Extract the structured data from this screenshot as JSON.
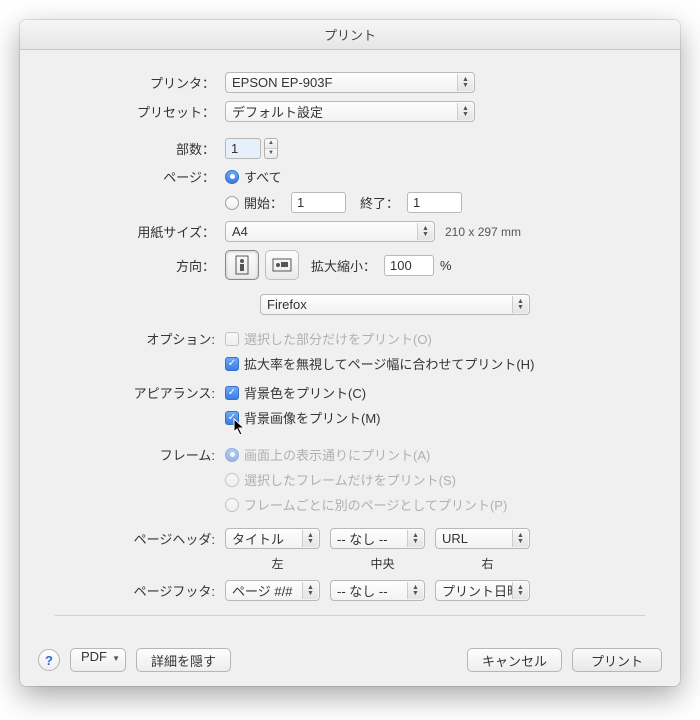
{
  "title": "プリント",
  "labels": {
    "printer": "プリンタ：",
    "preset": "プリセット：",
    "copies": "部数：",
    "pages": "ページ：",
    "all": "すべて",
    "from": "開始：",
    "to": "終了：",
    "paperSize": "用紙サイズ：",
    "paperSizeNote": "210 x 297 mm",
    "orientation": "方向：",
    "scale": "拡大縮小：",
    "percent": "%",
    "options": "オプション:",
    "appearance": "アピアランス:",
    "frame": "フレーム:",
    "header": "ページヘッダ:",
    "footer": "ページフッタ:",
    "hfLeft": "左",
    "hfCenter": "中央",
    "hfRight": "右"
  },
  "values": {
    "printer": "EPSON EP-903F",
    "preset": "デフォルト設定",
    "copies": "1",
    "from": "1",
    "to": "1",
    "paperSize": "A4",
    "scale": "100",
    "sectionApp": "Firefox",
    "headerLeft": "タイトル",
    "headerCenter": "-- なし --",
    "headerRight": "URL",
    "footerLeft": "ページ #/#",
    "footerCenter": "-- なし --",
    "footerRight": "プリント日時"
  },
  "options": {
    "selOnly": "選択した部分だけをプリント(O)",
    "shrink": "拡大率を無視してページ幅に合わせてプリント(H)",
    "bgColor": "背景色をプリント(C)",
    "bgImage": "背景画像をプリント(M)",
    "frameAsIs": "画面上の表示通りにプリント(A)",
    "frameSel": "選択したフレームだけをプリント(S)",
    "frameEach": "フレームごとに別のページとしてプリント(P)"
  },
  "footer": {
    "pdf": "PDF",
    "detail": "詳細を隠す",
    "cancel": "キャンセル",
    "print": "プリント"
  }
}
